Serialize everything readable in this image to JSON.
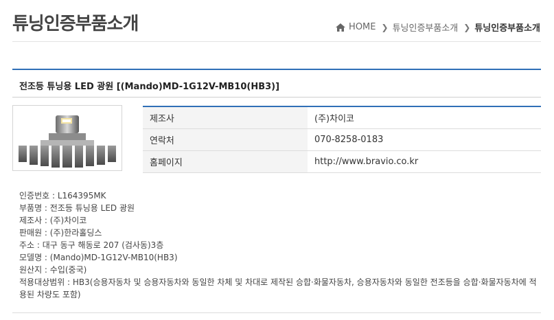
{
  "page": {
    "title": "튜닝인증부품소개"
  },
  "breadcrumb": {
    "home": "HOME",
    "level1": "튜닝인증부품소개",
    "level2": "튜닝인증부품소개"
  },
  "product": {
    "title": "전조등 튜닝용 LED 광원 [(Mando)MD-1G12V-MB10(HB3)]",
    "image_icon": "led-bulb-product-photo"
  },
  "info_table": [
    {
      "label": "제조사",
      "value": "(주)차이코"
    },
    {
      "label": "연락처",
      "value": "070-8258-0183"
    },
    {
      "label": "홈페이지",
      "value": "http://www.bravio.co.kr"
    }
  ],
  "specs": {
    "cert_no": "인증번호 : L164395MK",
    "part_name": "부품명 : 전조등 튜닝용 LED 광원",
    "manufacturer": "제조사 : (주)차이코",
    "seller": "판매원 : (주)한라홀딩스",
    "address": "주소 : 대구 동구 해동로 207 (검사동)3층",
    "model": "모델명 : (Mando)MD-1G12V-MB10(HB3)",
    "origin": "원산지 : 수입(중국)",
    "scope": "적용대상범위 : HB3(승용자동차 및 승용자동차와 동일한 차체 및 차대로 제작된 승합·화물자동차, 승용자동차와 동일한 전조등을 승합·화물자동차에 적용된 차량도 포함)"
  },
  "colors": {
    "accent_blue": "#2f6fb7",
    "label_bg": "#f4f4f4"
  }
}
